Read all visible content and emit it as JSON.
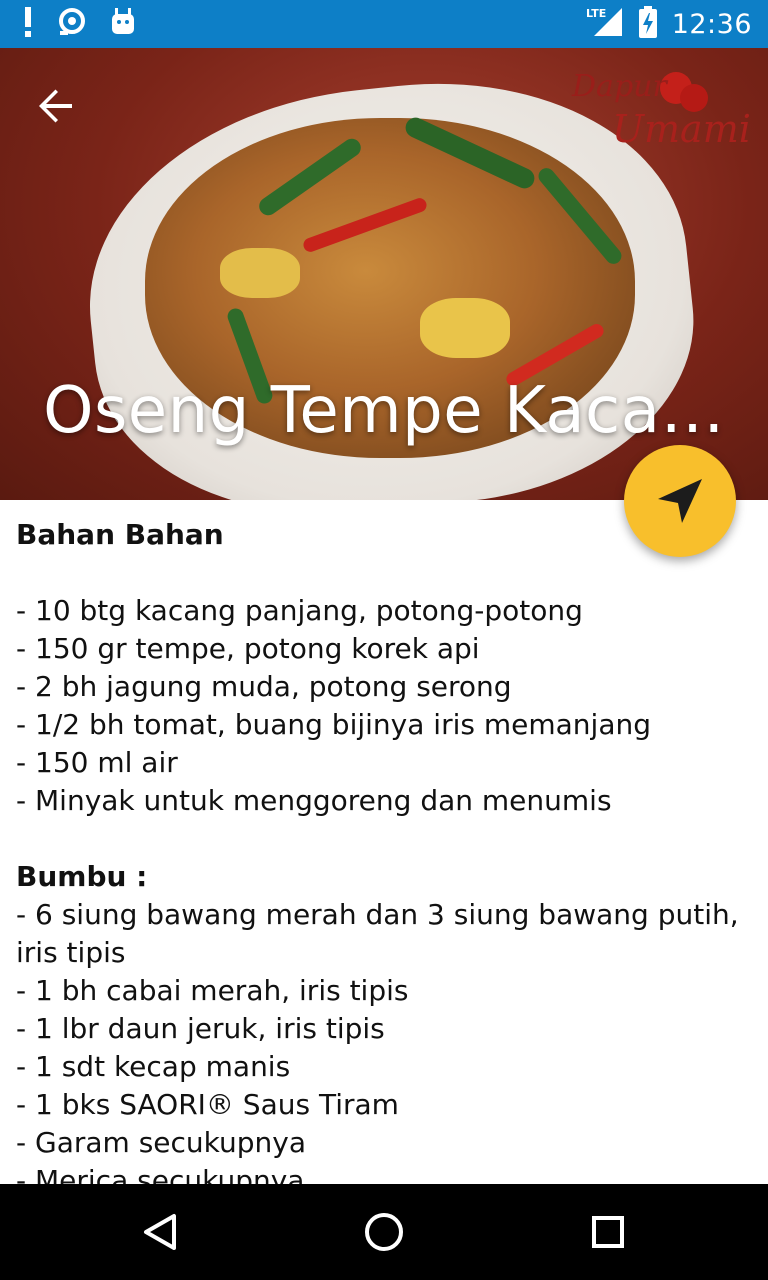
{
  "status_bar": {
    "time": "12:36",
    "network_label": "LTE",
    "icons": [
      "alert-icon",
      "sync-icon",
      "android-icon",
      "signal-icon",
      "battery-charging-icon"
    ]
  },
  "hero": {
    "title": "Oseng Tempe Kaca…",
    "brand_line1": "Dapur",
    "brand_line2": "Umami"
  },
  "content": {
    "ingredients_heading": "Bahan Bahan",
    "ingredients": [
      "- 10 btg kacang panjang, potong-potong",
      "- 150 gr tempe, potong korek api",
      "- 2 bh jagung muda, potong serong",
      "- 1/2 bh tomat, buang bijinya iris memanjang",
      "- 150 ml air",
      "- Minyak untuk menggoreng dan menumis"
    ],
    "spices_heading": "Bumbu :",
    "spices": [
      "- 6 siung bawang merah dan 3 siung bawang putih, iris tipis",
      "- 1 bh cabai merah, iris tipis",
      "- 1 lbr daun jeruk, iris tipis",
      "- 1 sdt kecap manis",
      "- 1 bks SAORI® Saus Tiram",
      "- Garam secukupnya",
      "- Merica secukupnya"
    ]
  },
  "colors": {
    "status_bar": "#0d7fc7",
    "fab": "#f8bf2c",
    "nav_bar": "#000000"
  }
}
